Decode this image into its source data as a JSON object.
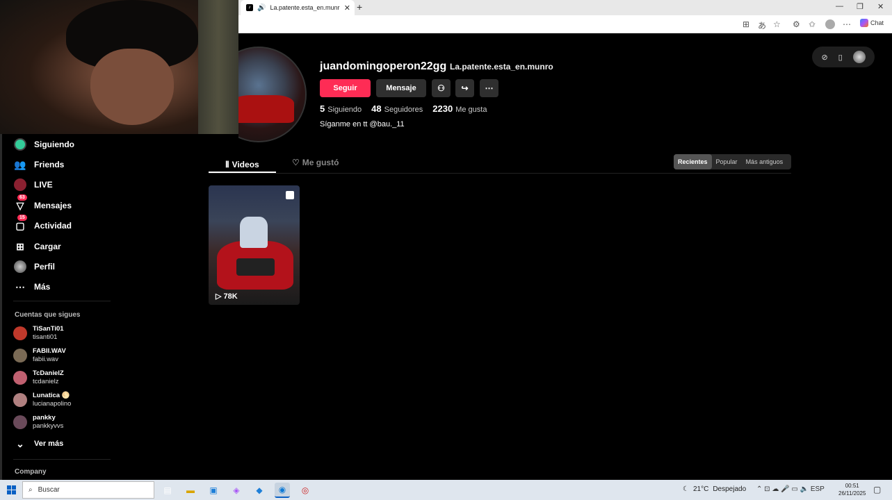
{
  "browser": {
    "tab_title": "La.patente.esta_en.munro (@",
    "tab_close": "✕",
    "new_tab": "+",
    "chat_label": "Chat"
  },
  "sidebar": {
    "items": [
      {
        "label": "Siguiendo",
        "icon": "following-icon",
        "badge": ""
      },
      {
        "label": "Friends",
        "icon": "friends-icon",
        "badge": ""
      },
      {
        "label": "LIVE",
        "icon": "live-icon",
        "badge": ""
      },
      {
        "label": "Mensajes",
        "icon": "messages-icon",
        "badge": "63"
      },
      {
        "label": "Actividad",
        "icon": "activity-icon",
        "badge": "15"
      },
      {
        "label": "Cargar",
        "icon": "upload-icon",
        "badge": ""
      },
      {
        "label": "Perfil",
        "icon": "profile-icon",
        "badge": ""
      },
      {
        "label": "Más",
        "icon": "more-icon",
        "badge": ""
      }
    ],
    "following_title": "Cuentas que sigues",
    "following": [
      {
        "name": "TiSanTi01",
        "handle": "tisanti01",
        "color": "#c0392b"
      },
      {
        "name": "FABII.WAV",
        "handle": "fabii.wav",
        "color": "#7a6a55"
      },
      {
        "name": "TcDanielZ",
        "handle": "tcdanielz",
        "color": "#c06070"
      },
      {
        "name": "Lunatica 🌕",
        "handle": "lucianapolino",
        "color": "#b08080"
      },
      {
        "name": "pankky",
        "handle": "pankkyvvs",
        "color": "#6a4a5a"
      }
    ],
    "see_more": "Ver más",
    "company": "Company"
  },
  "profile": {
    "username": "juandomingoperon22gg",
    "nickname": "La.patente.esta_en.munro",
    "follow_btn": "Seguir",
    "message_btn": "Mensaje",
    "stats": {
      "following_count": "5",
      "following_label": "Siguiendo",
      "followers_count": "48",
      "followers_label": "Seguidores",
      "likes_count": "2230",
      "likes_label": "Me gusta"
    },
    "bio": "Síganme en tt @bau._11"
  },
  "tabs": {
    "videos": "Videos",
    "liked": "Me gustó"
  },
  "sort": {
    "recent": "Recientes",
    "popular": "Popular",
    "oldest": "Más antiguos"
  },
  "videos": [
    {
      "views": "78K"
    }
  ],
  "taskbar": {
    "search_placeholder": "Buscar",
    "weather_temp": "21°C",
    "weather_desc": "Despejado",
    "lang": "ESP",
    "time": "00:51",
    "date": "26/11/2025"
  },
  "colors": {
    "accent": "#fe2c55",
    "background": "#000000"
  }
}
